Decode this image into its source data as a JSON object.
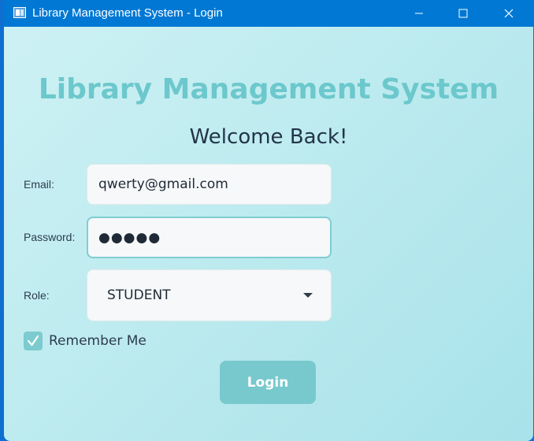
{
  "window": {
    "title": "Library Management System - Login",
    "controls": {
      "minimize": "minimize-icon",
      "maximize": "maximize-icon",
      "close": "close-icon"
    },
    "titlebar_color": "#0078d4"
  },
  "header": {
    "app_title": "Library Management System",
    "subtitle": "Welcome Back!"
  },
  "form": {
    "email": {
      "label": "Email:",
      "value": "qwerty@gmail.com"
    },
    "password": {
      "label": "Password:",
      "value": "●●●●●"
    },
    "role": {
      "label": "Role:",
      "selected": "STUDENT"
    },
    "remember_me": {
      "label": "Remember Me",
      "checked": true
    },
    "login_button": "Login"
  },
  "colors": {
    "accent": "#78c9cd",
    "title_teal": "#6cc8cc",
    "background_start": "#cdf1f4",
    "background_end": "#a8e2ea"
  }
}
